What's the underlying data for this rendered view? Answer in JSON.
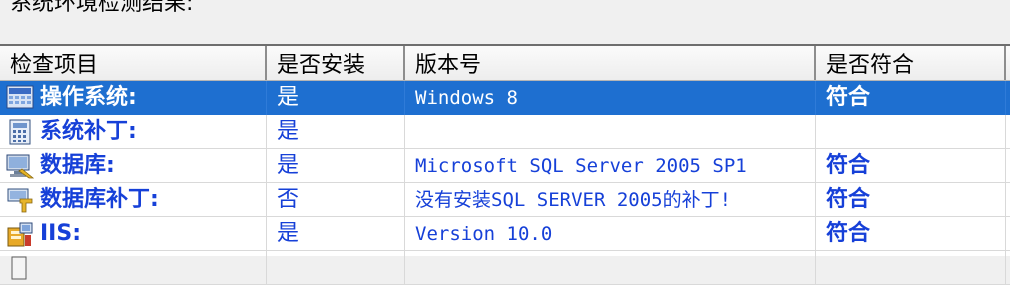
{
  "caption": "系统环境检测结果:",
  "columns": [
    "检查项目",
    "是否安装",
    "版本号",
    "是否符合"
  ],
  "rows": [
    {
      "item": "操作系统:",
      "installed": "是",
      "version": "Windows 8",
      "ok": "符合",
      "icon": "monitor-icon",
      "selected": true
    },
    {
      "item": "系统补丁:",
      "installed": "是",
      "version": "",
      "ok": "",
      "icon": "calculator-icon",
      "selected": false
    },
    {
      "item": "数据库:",
      "installed": "是",
      "version": "Microsoft SQL Server 2005 SP1",
      "ok": "符合",
      "icon": "database-icon",
      "selected": false
    },
    {
      "item": "数据库补丁:",
      "installed": "否",
      "version": "没有安装SQL SERVER 2005的补丁!",
      "ok": "符合",
      "icon": "patch-icon",
      "selected": false
    },
    {
      "item": "IIS:",
      "installed": "是",
      "version": "Version 10.0",
      "ok": "符合",
      "icon": "server-icon",
      "selected": false
    }
  ],
  "colors": {
    "selection": "#1e6fd0",
    "text_blue": "#1640d8"
  }
}
